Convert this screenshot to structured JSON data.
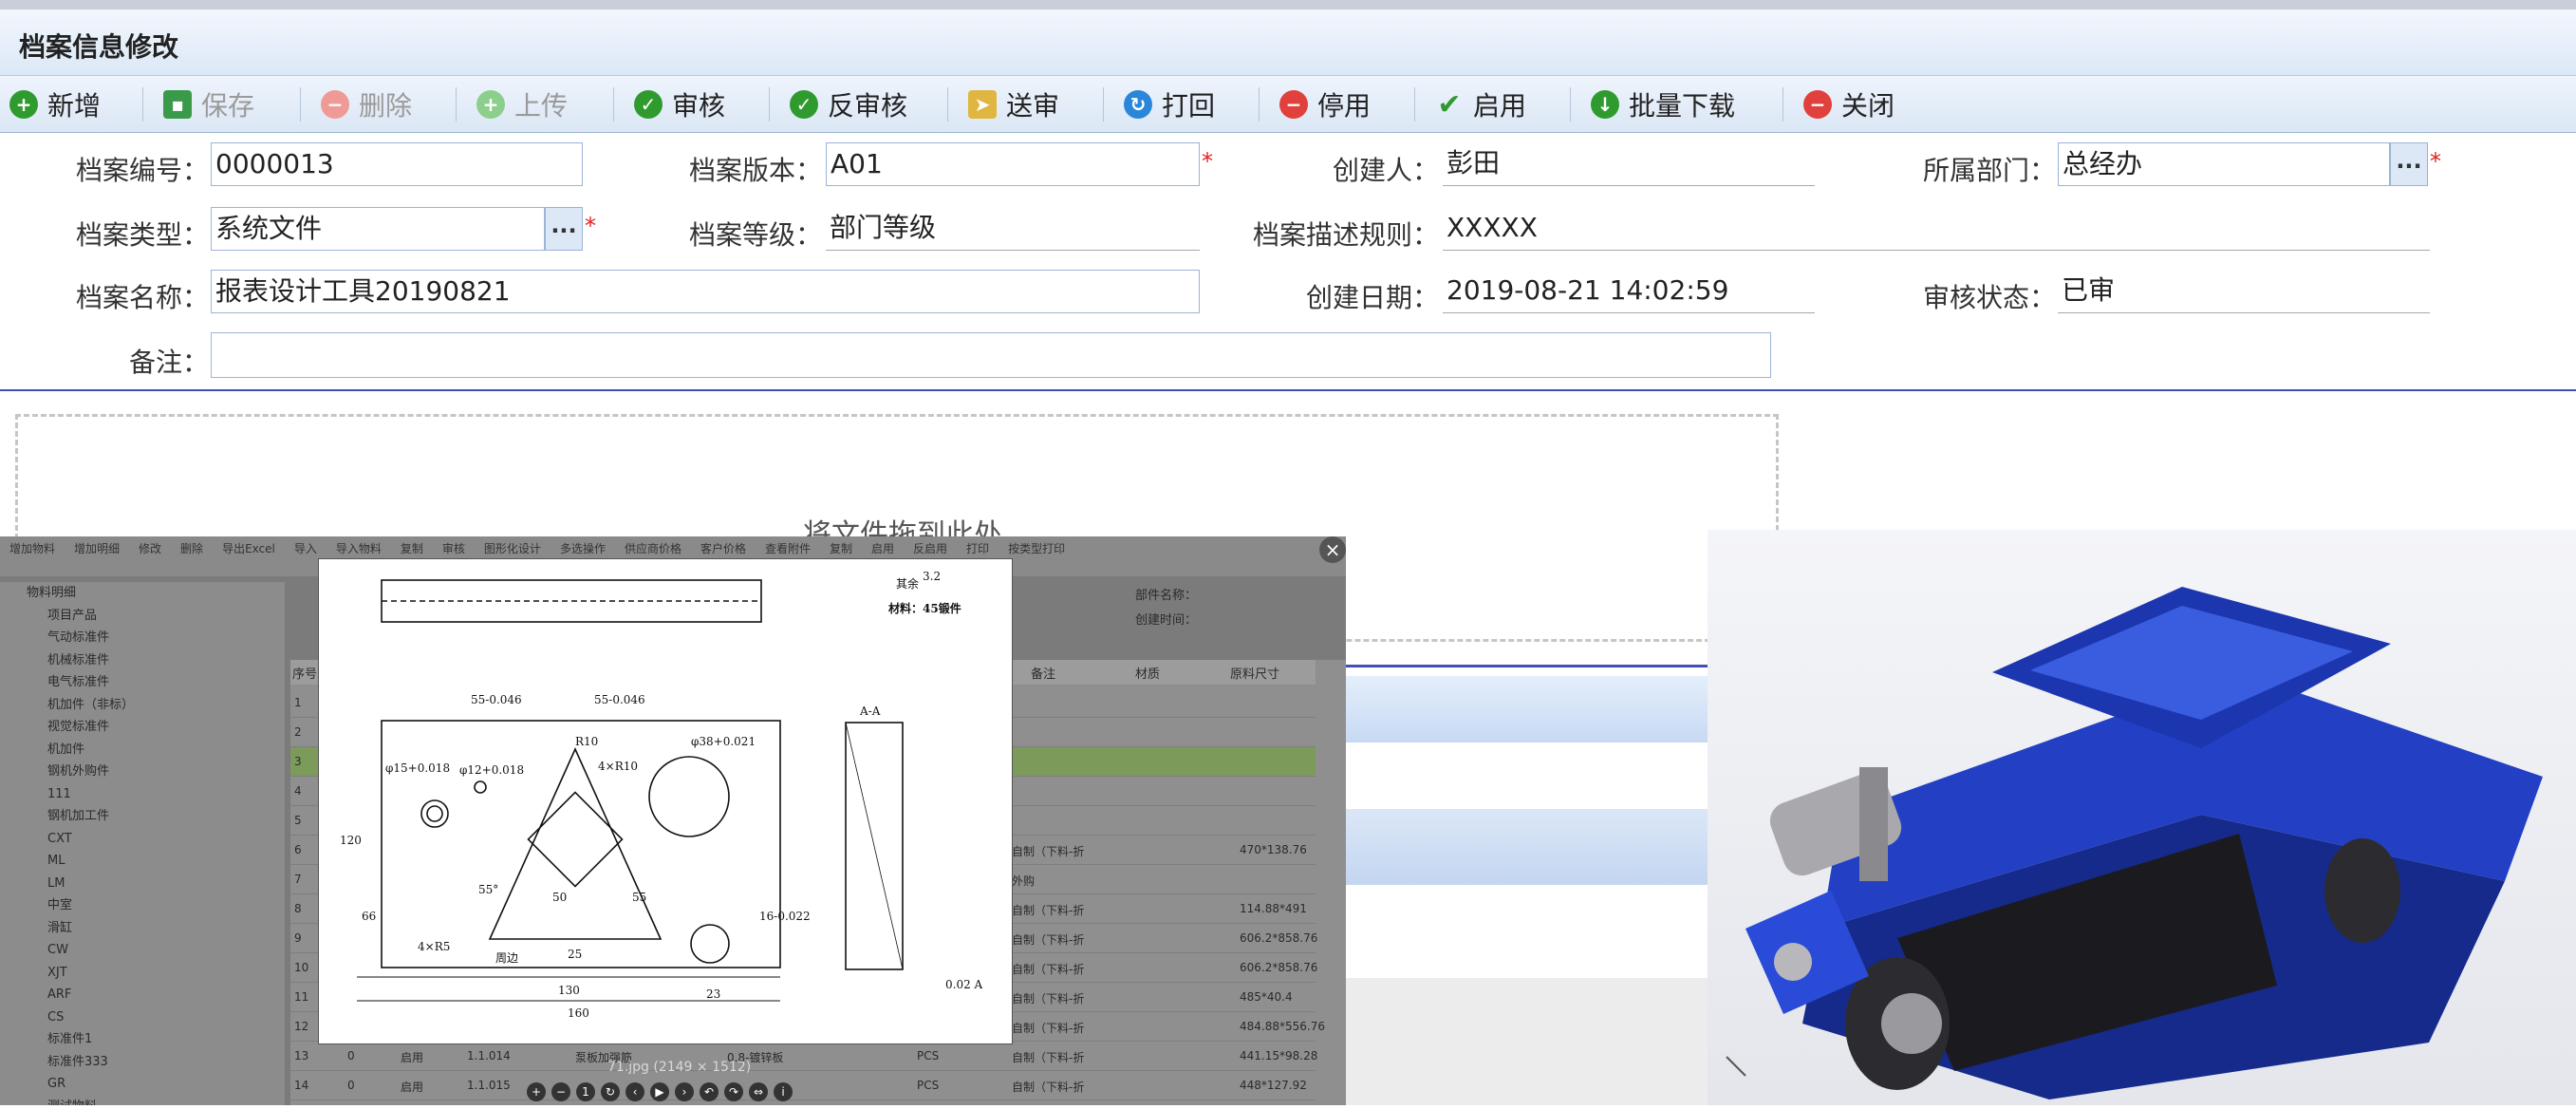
{
  "window": {
    "title": "档案信息修改"
  },
  "toolbar": {
    "add": "新增",
    "save": "保存",
    "delete": "删除",
    "upload": "上传",
    "audit": "审核",
    "unaudit": "反审核",
    "submit": "送审",
    "return": "打回",
    "disable": "停用",
    "enable": "启用",
    "batch_download": "批量下载",
    "close": "关闭"
  },
  "form": {
    "code_label": "档案编号：",
    "code_value": "0000013",
    "version_label": "档案版本：",
    "version_value": "A01",
    "creator_label": "创建人：",
    "creator_value": "彭田",
    "dept_label": "所属部门：",
    "dept_value": "总经办",
    "type_label": "档案类型：",
    "type_value": "系统文件",
    "level_label": "档案等级：",
    "level_value": "部门等级",
    "rule_label": "档案描述规则：",
    "rule_value": "XXXXX",
    "name_label": "档案名称：",
    "name_value": "报表设计工具20190821",
    "date_label": "创建日期：",
    "date_value": "2019-08-21 14:02:59",
    "status_label": "审核状态：",
    "status_value": "已审",
    "note_label": "备注：",
    "note_value": "",
    "dots": "...",
    "required": "*"
  },
  "dropzone": {
    "text": "将文件拖到此处"
  },
  "viewer": {
    "toolbar_items": [
      "增加物料",
      "增加明细",
      "修改",
      "删除",
      "导出Excel",
      "导入",
      "导入物料",
      "复制",
      "审核",
      "图形化设计",
      "多选操作",
      "供应商价格",
      "客户价格",
      "查看附件",
      "复制",
      "启用",
      "反启用",
      "打印",
      "按类型打印"
    ],
    "tree": [
      {
        "label": "物料明细",
        "sub": false
      },
      {
        "label": "项目产品",
        "sub": true
      },
      {
        "label": "气动标准件",
        "sub": true
      },
      {
        "label": "机械标准件",
        "sub": true
      },
      {
        "label": "电气标准件",
        "sub": true
      },
      {
        "label": "机加件（非标）",
        "sub": true
      },
      {
        "label": "视觉标准件",
        "sub": true
      },
      {
        "label": "机加件",
        "sub": true
      },
      {
        "label": "钢机外购件",
        "sub": true
      },
      {
        "label": "111",
        "sub": true
      },
      {
        "label": "钢机加工件",
        "sub": true
      },
      {
        "label": "CXT",
        "sub": true
      },
      {
        "label": "ML",
        "sub": true
      },
      {
        "label": "LM",
        "sub": true
      },
      {
        "label": "中室",
        "sub": true
      },
      {
        "label": "滑缸",
        "sub": true
      },
      {
        "label": "CW",
        "sub": true
      },
      {
        "label": "XJT",
        "sub": true
      },
      {
        "label": "ARF",
        "sub": true
      },
      {
        "label": "CS",
        "sub": true
      },
      {
        "label": "标准件1",
        "sub": true
      },
      {
        "label": "标准件333",
        "sub": true
      },
      {
        "label": "GR",
        "sub": true
      },
      {
        "label": "测试物料",
        "sub": true
      }
    ],
    "grid_headers": [
      "序号",
      "备注",
      "材质",
      "原料尺寸"
    ],
    "side_labels": [
      "部件名称：",
      "创建时间："
    ],
    "rows": [
      {
        "n": "1",
        "a": "",
        "b": "",
        "c": "",
        "d": "",
        "e": ""
      },
      {
        "n": "2",
        "a": "",
        "b": "",
        "c": "",
        "d": "",
        "e": ""
      },
      {
        "n": "3",
        "a": "",
        "b": "",
        "c": "",
        "d": "",
        "e": ""
      },
      {
        "n": "4",
        "a": "",
        "b": "",
        "c": "",
        "d": "",
        "e": ""
      },
      {
        "n": "5",
        "a": "",
        "b": "",
        "c": "",
        "d": "",
        "e": ""
      },
      {
        "n": "6",
        "a": "",
        "b": "",
        "c": "",
        "d": "自制（下料-折",
        "e": "470*138.76"
      },
      {
        "n": "7",
        "a": "",
        "b": "",
        "c": "",
        "d": "外购",
        "e": ""
      },
      {
        "n": "8",
        "a": "",
        "b": "",
        "c": "",
        "d": "自制（下料-折",
        "e": "114.88*491"
      },
      {
        "n": "9",
        "a": "",
        "b": "",
        "c": "",
        "d": "自制（下料-折",
        "e": "606.2*858.76"
      },
      {
        "n": "10",
        "a": "",
        "b": "",
        "c": "",
        "d": "自制（下料-折",
        "e": "606.2*858.76"
      },
      {
        "n": "11",
        "a": "",
        "b": "",
        "c": "",
        "d": "自制（下料-折",
        "e": "485*40.4"
      },
      {
        "n": "12",
        "a": "",
        "b": "",
        "c": "",
        "d": "自制（下料-折",
        "e": "484.88*556.76"
      },
      {
        "n": "13",
        "a": "0",
        "b": "启用",
        "c": "1.1.014",
        "d": "自制（下料-折",
        "e": "441.15*98.28"
      },
      {
        "n": "14",
        "a": "0",
        "b": "启用",
        "c": "1.1.015",
        "d": "自制（下料-折",
        "e": "448*127.92"
      }
    ],
    "row13_name": "泵板加强筋",
    "row13_spec": "0.8-镀锌板",
    "row13_unit": "PCS",
    "row14_unit": "PCS",
    "caption": "71.jpg (2149 × 1512)",
    "drawing": {
      "note1": "其余",
      "note2": "材料：45锻件",
      "roughness": "3.2",
      "d1": "55-0.046",
      "d2": "55-0.046",
      "r10": "R10",
      "d38": "φ38+0.021",
      "d15": "φ15+0.018",
      "d12": "φ12+0.018",
      "dim120": "120",
      "dim130": "130",
      "dim160": "160",
      "dim25": "25",
      "dim23": "23",
      "dim50": "50",
      "dim55": "55",
      "dim66": "66",
      "r4": "4×R5",
      "a55": "55°",
      "sec": "A-A",
      "tol": "0.02 A",
      "dim16": "16-0.022",
      "r40": "4×R10",
      "weld": "周边"
    }
  },
  "colors": {
    "accent": "#3f4fb5",
    "toolbar_bg": "#dbe7f5",
    "machine_blue": "#1c2ea0"
  }
}
